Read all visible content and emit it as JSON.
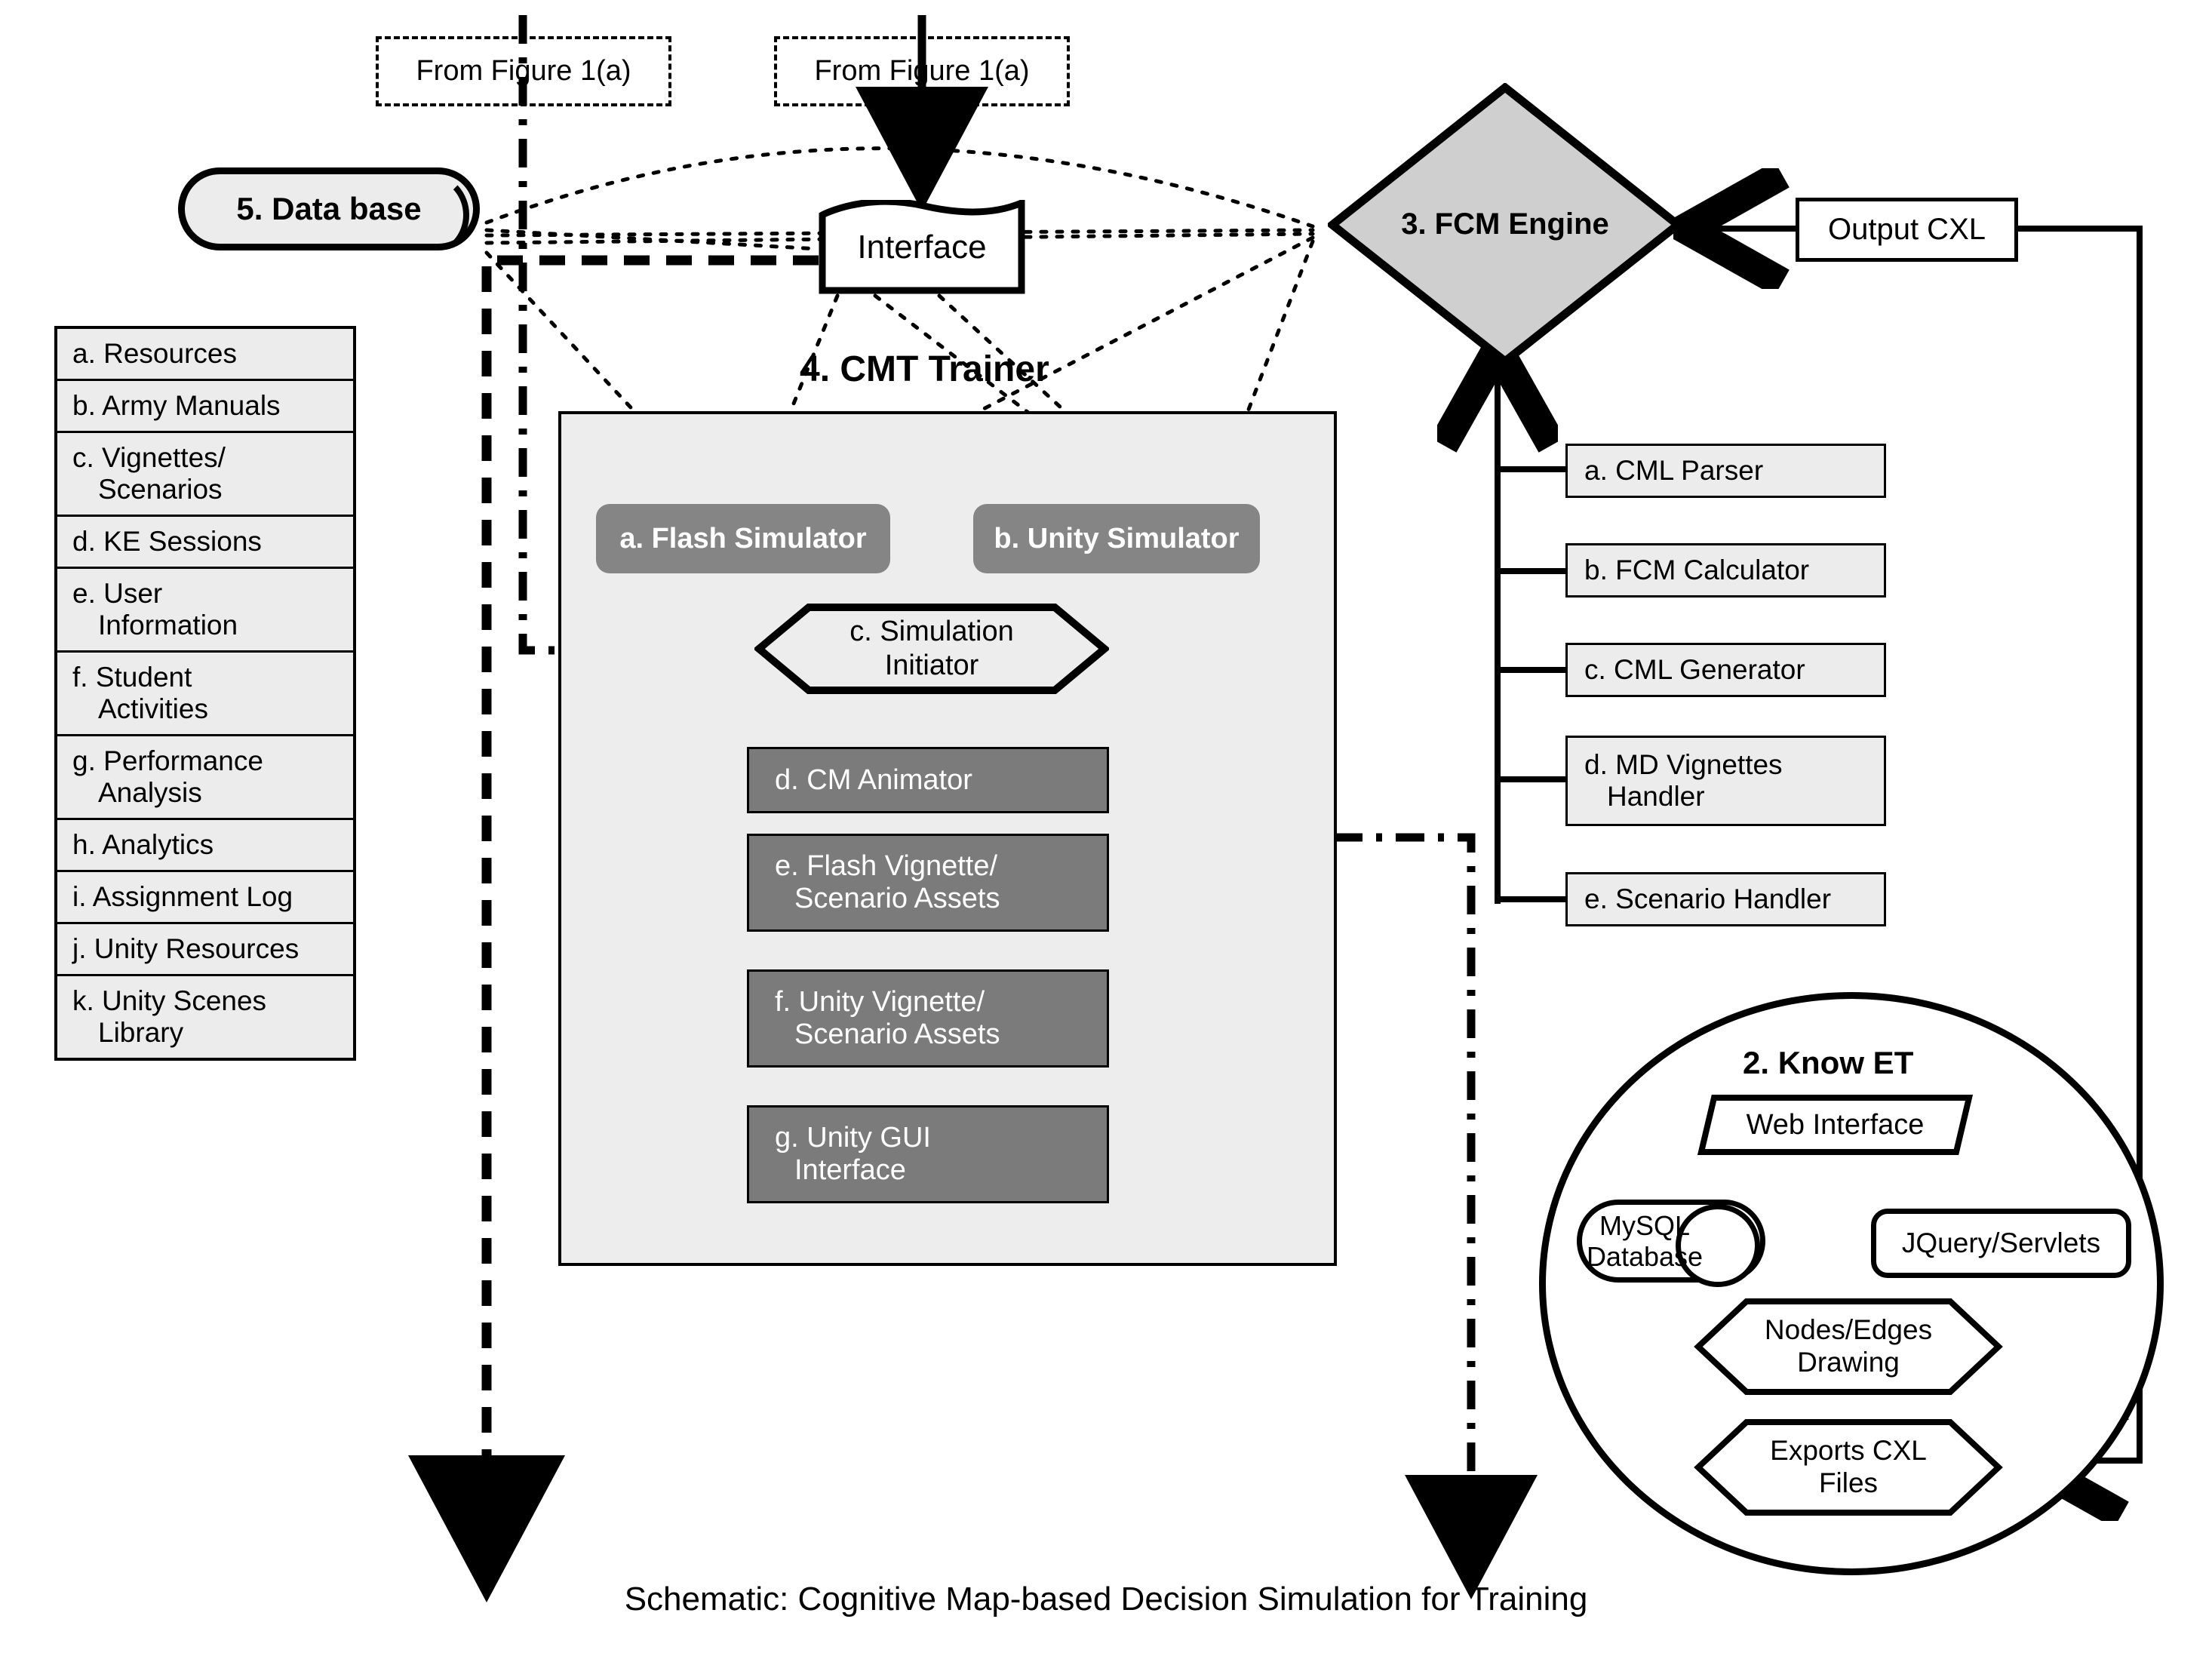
{
  "caption": "Schematic: Cognitive Map-based Decision Simulation for Training",
  "from_figure_tags": [
    {
      "label": "From Figure 1(a)"
    },
    {
      "label": "From Figure 1(a)"
    }
  ],
  "database": {
    "label": "5. Data base",
    "items": [
      {
        "line1": "a. Resources",
        "line2": ""
      },
      {
        "line1": "b. Army Manuals",
        "line2": ""
      },
      {
        "line1": "c. Vignettes/",
        "line2": "Scenarios"
      },
      {
        "line1": "d. KE Sessions",
        "line2": ""
      },
      {
        "line1": "e. User",
        "line2": "Information"
      },
      {
        "line1": "f. Student",
        "line2": "Activities"
      },
      {
        "line1": "g. Performance",
        "line2": "Analysis"
      },
      {
        "line1": "h. Analytics",
        "line2": ""
      },
      {
        "line1": "i. Assignment Log",
        "line2": ""
      },
      {
        "line1": "j. Unity Resources",
        "line2": ""
      },
      {
        "line1": "k. Unity Scenes",
        "line2": "Library"
      }
    ]
  },
  "interface": {
    "label": "Interface"
  },
  "fcm_engine": {
    "label": "3. FCM Engine",
    "components": [
      {
        "line1": "a. CML Parser",
        "line2": ""
      },
      {
        "line1": "b. FCM Calculator",
        "line2": ""
      },
      {
        "line1": "c. CML Generator",
        "line2": ""
      },
      {
        "line1": "d. MD Vignettes",
        "line2": "Handler"
      },
      {
        "line1": "e. Scenario Handler",
        "line2": ""
      }
    ]
  },
  "output_cxl": {
    "label": "Output CXL"
  },
  "cmt_trainer": {
    "title": "4. CMT Trainer",
    "flash_simulator": "a.  Flash  Simulator",
    "unity_simulator": "b.  Unity  Simulator",
    "simulation_initiator": {
      "line1": "c. Simulation",
      "line2": "Initiator"
    },
    "modules": [
      {
        "line1": "d.  CM Animator",
        "line2": ""
      },
      {
        "line1": "e.  Flash  Vignette/",
        "line2": "Scenario Assets"
      },
      {
        "line1": "f.  Unity  Vignette/",
        "line2": "Scenario Assets"
      },
      {
        "line1": "g.  Unity  GUI",
        "line2": "Interface"
      }
    ]
  },
  "know_et": {
    "title": "2. Know ET",
    "web_interface": "Web Interface",
    "mysql": {
      "line1": "MySQL",
      "line2": "Database"
    },
    "jquery": "JQuery/Servlets",
    "nodes_edges": {
      "line1": "Nodes/Edges",
      "line2": "Drawing"
    },
    "exports_cxl": {
      "line1": "Exports CXL",
      "line2": "Files"
    }
  },
  "colors": {
    "fill_light": "#ececec",
    "fill_panel": "#ededed",
    "fill_sim": "#858585",
    "fill_module": "#7b7b7b",
    "stroke": "#000000"
  }
}
